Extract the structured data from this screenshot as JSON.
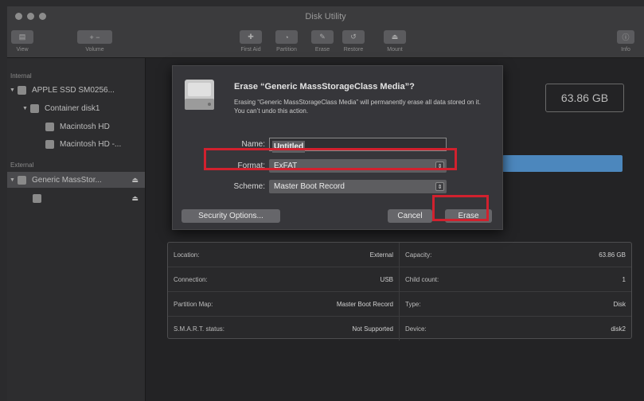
{
  "window": {
    "title": "Disk Utility"
  },
  "toolbar": {
    "view_label": "View",
    "volume_label": "Volume",
    "first_aid_label": "First Aid",
    "partition_label": "Partition",
    "erase_label": "Erase",
    "restore_label": "Restore",
    "mount_label": "Mount",
    "info_label": "Info"
  },
  "sidebar": {
    "internal_header": "Internal",
    "external_header": "External",
    "items": [
      {
        "label": "APPLE SSD SM0256..."
      },
      {
        "label": "Container disk1"
      },
      {
        "label": "Macintosh HD"
      },
      {
        "label": "Macintosh HD -..."
      },
      {
        "label": "Generic MassStor..."
      }
    ]
  },
  "main": {
    "capacity_display": "63.86 GB",
    "info": {
      "location_label": "Location:",
      "location_value": "External",
      "capacity_label": "Capacity:",
      "capacity_value": "63.86 GB",
      "connection_label": "Connection:",
      "connection_value": "USB",
      "child_count_label": "Child count:",
      "child_count_value": "1",
      "partition_map_label": "Partition Map:",
      "partition_map_value": "Master Boot Record",
      "type_label": "Type:",
      "type_value": "Disk",
      "smart_label": "S.M.A.R.T. status:",
      "smart_value": "Not Supported",
      "device_label": "Device:",
      "device_value": "disk2"
    }
  },
  "dialog": {
    "title": "Erase “Generic MassStorageClass Media”?",
    "message": "Erasing “Generic MassStorageClass Media” will permanently erase all data stored on it. You can’t undo this action.",
    "name_label": "Name:",
    "name_value": "Untitled",
    "format_label": "Format:",
    "format_value": "ExFAT",
    "scheme_label": "Scheme:",
    "scheme_value": "Master Boot Record",
    "security_button": "Security Options...",
    "cancel_button": "Cancel",
    "erase_button": "Erase"
  },
  "colors": {
    "highlight": "#d1212e",
    "selection_blue": "#4c87bd",
    "dialog_bg": "#36363a"
  },
  "icons": [
    "sidebar-icon",
    "volume-icon",
    "first-aid-icon",
    "partition-icon",
    "erase-icon",
    "restore-icon",
    "mount-icon",
    "info-icon",
    "disk-icon",
    "eject-icon",
    "hard-drive-icon",
    "chevron-updown-icon"
  ]
}
